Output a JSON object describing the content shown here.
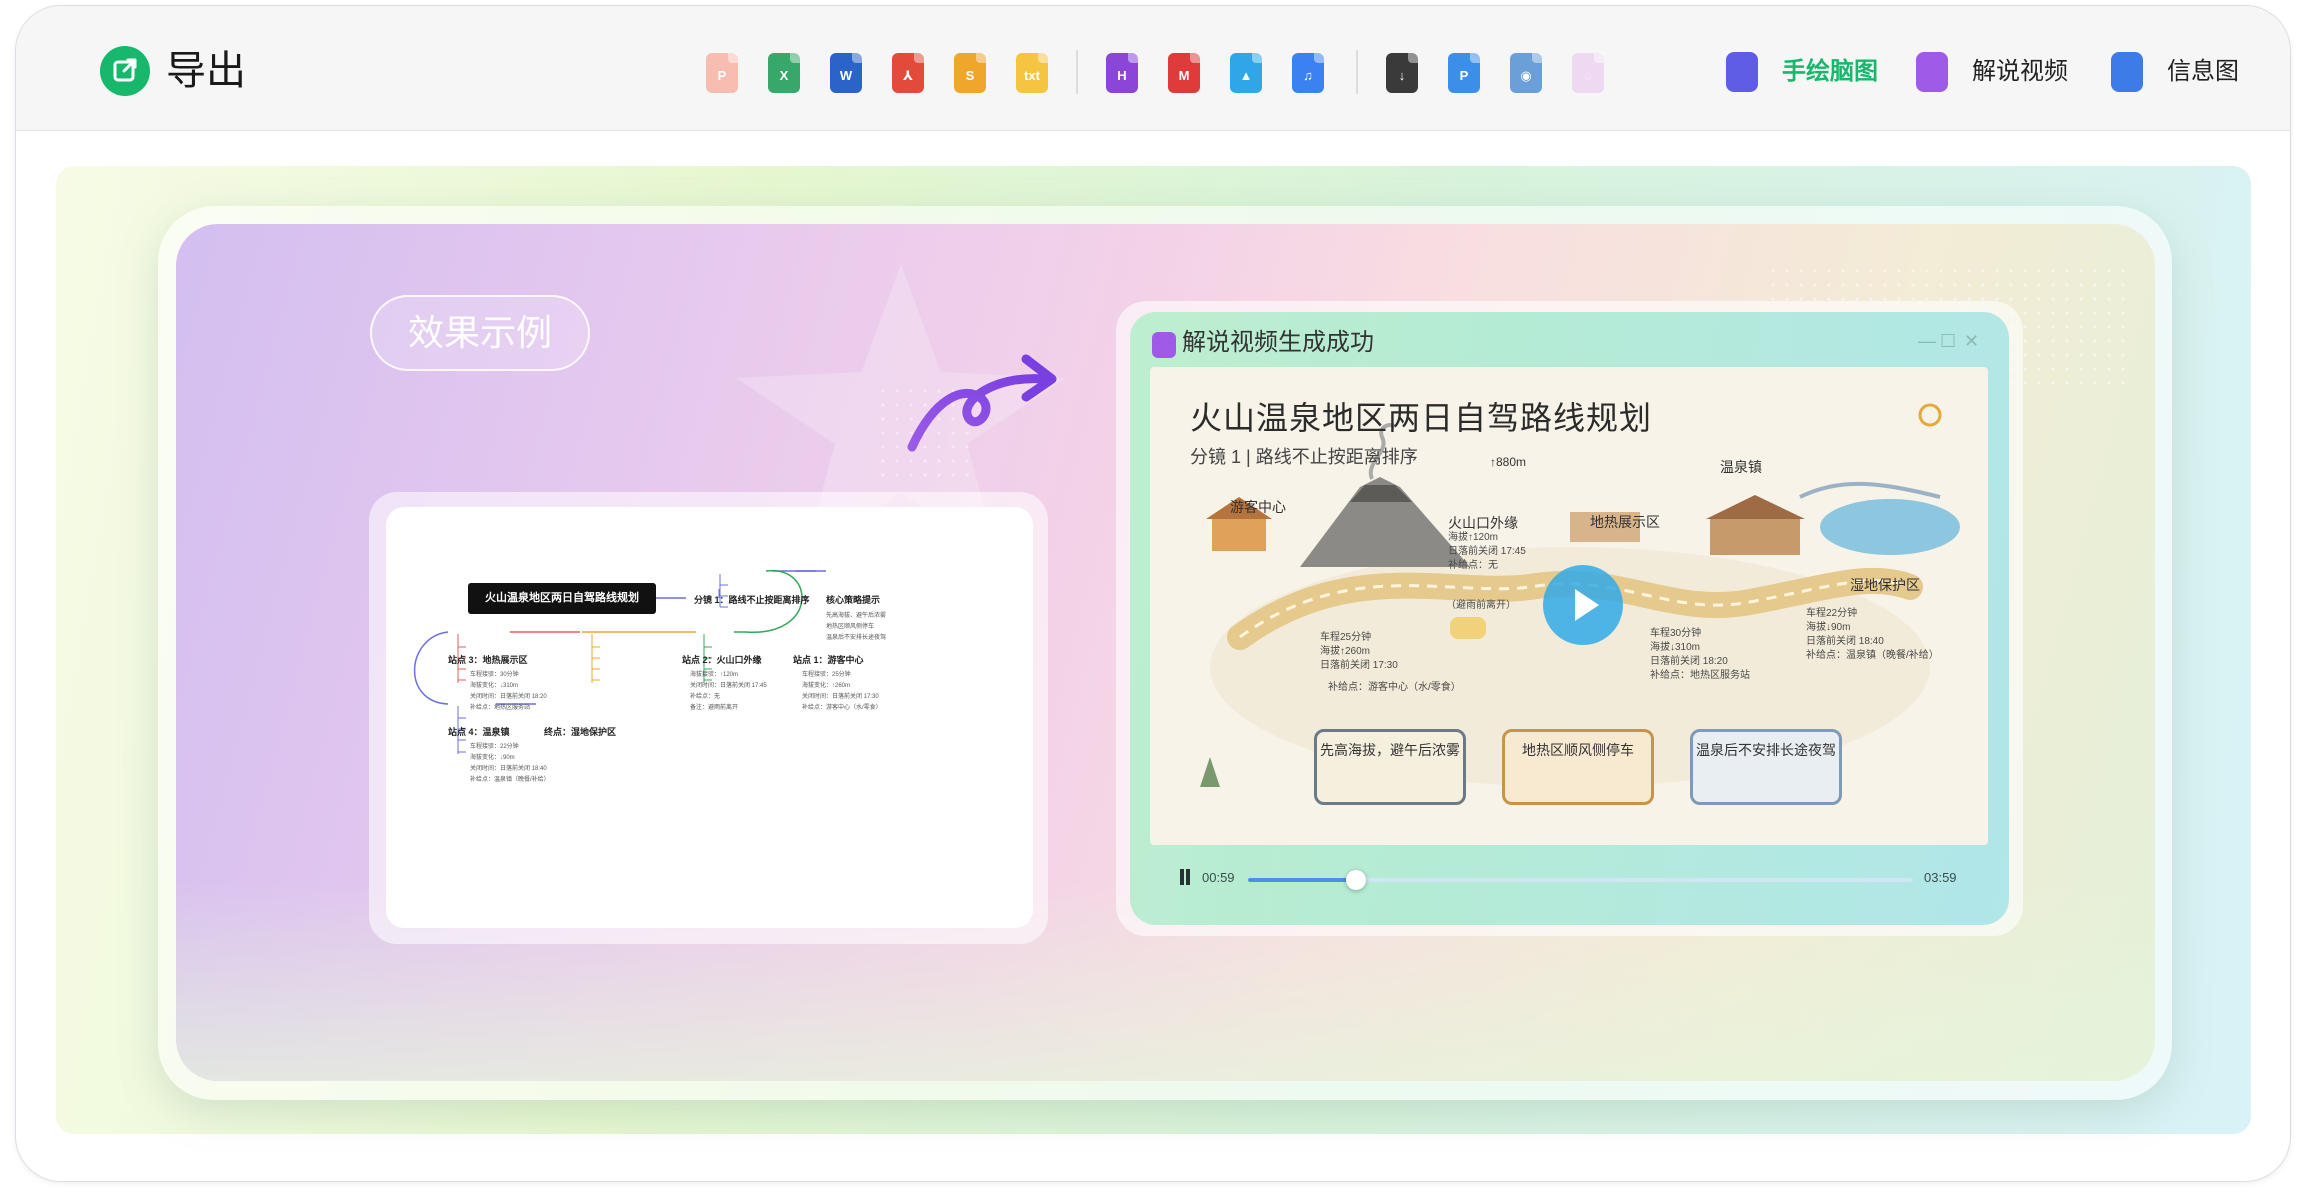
{
  "header": {
    "title": "导出",
    "formats": [
      {
        "name": "ppt",
        "glyph": "P",
        "color": "#f7bdb0"
      },
      {
        "name": "excel",
        "glyph": "X",
        "color": "#37a86a"
      },
      {
        "name": "word",
        "glyph": "W",
        "color": "#2c63c9"
      },
      {
        "name": "pdf",
        "glyph": "⅄",
        "color": "#e24a3b"
      },
      {
        "name": "pages",
        "glyph": "S",
        "color": "#f0a52c"
      },
      {
        "name": "txt",
        "glyph": "txt",
        "color": "#f5c542"
      },
      {
        "name": "html",
        "glyph": "H",
        "color": "#8b45d8"
      },
      {
        "name": "markdown",
        "glyph": "M",
        "color": "#e03b3b"
      },
      {
        "name": "image",
        "glyph": "▲",
        "color": "#2fa6e8"
      },
      {
        "name": "audio",
        "glyph": "♫",
        "color": "#3b82f0"
      },
      {
        "name": "download",
        "glyph": "↓",
        "color": "#3a3a3a"
      },
      {
        "name": "pdf-blue",
        "glyph": "P",
        "color": "#3b8fe8"
      },
      {
        "name": "disc",
        "glyph": "◉",
        "color": "#6a9fd8"
      },
      {
        "name": "faded",
        "glyph": "◌",
        "color": "#eed8f2"
      }
    ],
    "tools": [
      {
        "label": "手绘脑图",
        "color": "#17b86c",
        "icon_color": "#5f5ce6"
      },
      {
        "label": "解说视频",
        "color": "#222222",
        "icon_color": "#a05ae8"
      },
      {
        "label": "信息图",
        "color": "#222222",
        "icon_color": "#3d7be8"
      }
    ]
  },
  "card": {
    "badge": "效果示例"
  },
  "mindmap": {
    "root": "火山温泉地区两日自驾路线规划",
    "branch1": "分镜 1：路线不止按距离排序",
    "strategy": {
      "title": "核心策略提示",
      "items": [
        "先高海拔、避午后浓雾",
        "地热区顺风侧停车",
        "温泉后不安排长途夜驾"
      ]
    },
    "stop1": {
      "title": "站点 1：游客中心",
      "items": [
        "车程接驳：25分钟",
        "海拔变化：↑260m",
        "关闭时间：日落前关闭 17:30",
        "补给点：游客中心（水/零食）"
      ]
    },
    "stop2": {
      "title": "站点 2：火山口外缘",
      "items": [
        "海拔接驳：↑120m",
        "关闭时间：日落前关闭 17:45",
        "补给点：无",
        "备注：避雨前离开"
      ]
    },
    "stop3": {
      "title": "站点 3：地热展示区",
      "items": [
        "车程接驳：30分钟",
        "海拔变化：↓310m",
        "关闭时间：日落前关闭 18:20",
        "补给点：地热区服务站"
      ]
    },
    "stop4": {
      "title": "站点 4：温泉镇",
      "items": [
        "车程接驳：22分钟",
        "海拔变化：↓90m",
        "关闭时间：日落前关闭 18:40",
        "补给点：温泉镇（晚餐/补给）"
      ]
    },
    "end": "终点：湿地保护区"
  },
  "video": {
    "panel_title": "解说视频生成成功",
    "window_controls": {
      "minimize": "—",
      "maximize": "☐",
      "close": "✕"
    },
    "scene": {
      "title": "火山温泉地区两日自驾路线规划",
      "subtitle": "分镜 1 | 路线不止按距离排序",
      "places": {
        "visitor": "游客中心",
        "crater": "火山口外缘",
        "geo": "地热展示区",
        "town": "温泉镇",
        "wetland": "湿地保护区",
        "alt": "↑880m"
      },
      "notes": {
        "n1": [
          "车程25分钟",
          "海拔↑260m",
          "日落前关闭 17:30"
        ],
        "n1_supply": "补给点：游客中心（水/零食）",
        "n2": [
          "海拔↑120m",
          "日落前关闭 17:45",
          "补给点：无"
        ],
        "n2_extra": "（避雨前离开）",
        "n3": [
          "车程30分钟",
          "海拔↓310m",
          "日落前关闭 18:20",
          "补给点：地热区服务站"
        ],
        "n4": [
          "车程22分钟",
          "海拔↓90m",
          "日落前关闭 18:40",
          "补给点：温泉镇（晚餐/补给）"
        ]
      },
      "tips": [
        "先高海拔，避午后浓雾",
        "地热区顺风侧停车",
        "温泉后不安排长途夜驾"
      ]
    },
    "player": {
      "current": "00:59",
      "total": "03:59",
      "progress": 0.163
    }
  }
}
